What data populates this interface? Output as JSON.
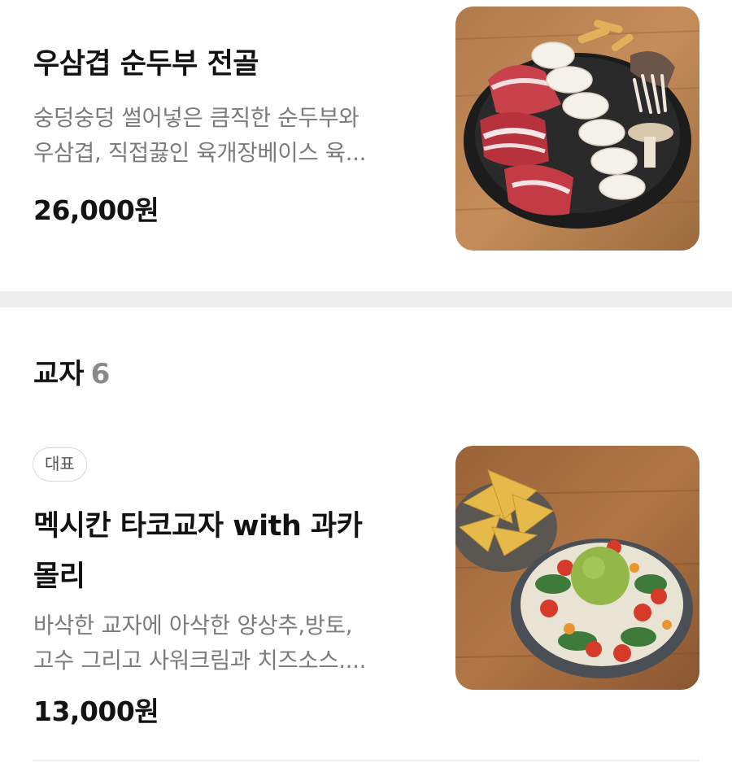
{
  "items": [
    {
      "title": "우삼겹 순두부 전골",
      "desc_lines": [
        "숭덩숭덩 썰어넣은 큼직한 순두부와",
        "우삼겹, 직접끓인 육개장베이스 육..."
      ],
      "price": "26,000원",
      "image_icon": "hotpot-photo-icon"
    },
    {
      "badge": "대표",
      "title_lines": [
        "멕시칸 타코교자 with 과카",
        "몰리"
      ],
      "desc_lines": [
        "바삭한 교자에 아삭한 양상추,방토,",
        "고수 그리고 사워크림과 치즈소스...."
      ],
      "price": "13,000원",
      "image_icon": "nacho-salad-photo-icon"
    }
  ],
  "section": {
    "title": "교자",
    "count": "6"
  }
}
